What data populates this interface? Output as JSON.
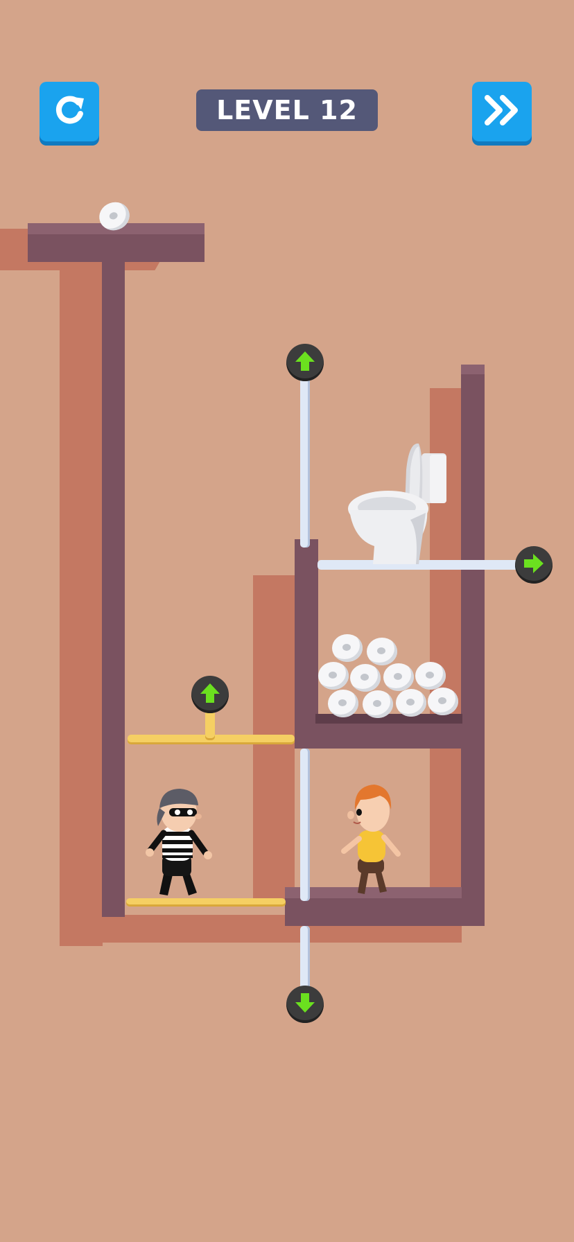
{
  "hud": {
    "level_label": "LEVEL 12",
    "restart_icon": "restart-icon",
    "skip_icon": "fast-forward-icon"
  },
  "colors": {
    "background": "#d4a48a",
    "wall": "#7a5260",
    "button": "#1aa3ee",
    "level_pill": "#545878",
    "pin_arrow": "#6be01f",
    "gold_pin": "#f5cf63",
    "white_pin": "#dfe8f6"
  },
  "pins": [
    {
      "name": "top-vertical-pin",
      "arrow": "up",
      "color": "white"
    },
    {
      "name": "toilet-shelf-pin",
      "arrow": "right",
      "color": "white"
    },
    {
      "name": "gold-upper-pin",
      "arrow": "up",
      "color": "gold"
    },
    {
      "name": "bottom-vertical-pin",
      "arrow": "down",
      "color": "white"
    }
  ],
  "characters": {
    "thief": "thief-character",
    "boy": "boy-character"
  },
  "objects": {
    "toilet": "toilet",
    "paper_roll_stack": "toilet-paper-stack",
    "single_roll": "toilet-paper-roll"
  }
}
